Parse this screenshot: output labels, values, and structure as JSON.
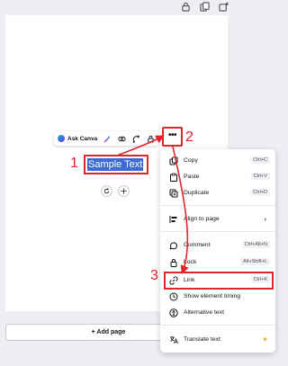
{
  "top_icons": [
    "lock-icon",
    "duplicate-page-icon",
    "add-page-icon"
  ],
  "toolbar": {
    "ask_canva": "Ask Canva",
    "more_label": "•••"
  },
  "selection": {
    "text": "Sample Text"
  },
  "annotations": {
    "one": "1",
    "two": "2",
    "three": "3",
    "color": "#e0252b"
  },
  "add_page": "+ Add page",
  "menu": {
    "items": [
      {
        "label": "Copy",
        "shortcut": "Ctrl+C",
        "icon": "copy-icon"
      },
      {
        "label": "Paste",
        "shortcut": "Ctrl+V",
        "icon": "paste-icon"
      },
      {
        "label": "Duplicate",
        "shortcut": "Ctrl+D",
        "icon": "duplicate-icon"
      },
      {
        "label": "Align to page",
        "shortcut": "",
        "icon": "align-icon"
      },
      {
        "label": "Comment",
        "shortcut": "Ctrl+Alt+N",
        "icon": "comment-icon"
      },
      {
        "label": "Lock",
        "shortcut": "Alt+Shift+L",
        "icon": "lock-icon"
      },
      {
        "label": "Link",
        "shortcut": "Ctrl+K",
        "icon": "link-icon"
      },
      {
        "label": "Show element timing",
        "shortcut": "",
        "icon": "timing-icon"
      },
      {
        "label": "Alternative text",
        "shortcut": "",
        "icon": "accessibility-icon"
      },
      {
        "label": "Translate text",
        "shortcut": "",
        "icon": "translate-icon"
      }
    ]
  }
}
